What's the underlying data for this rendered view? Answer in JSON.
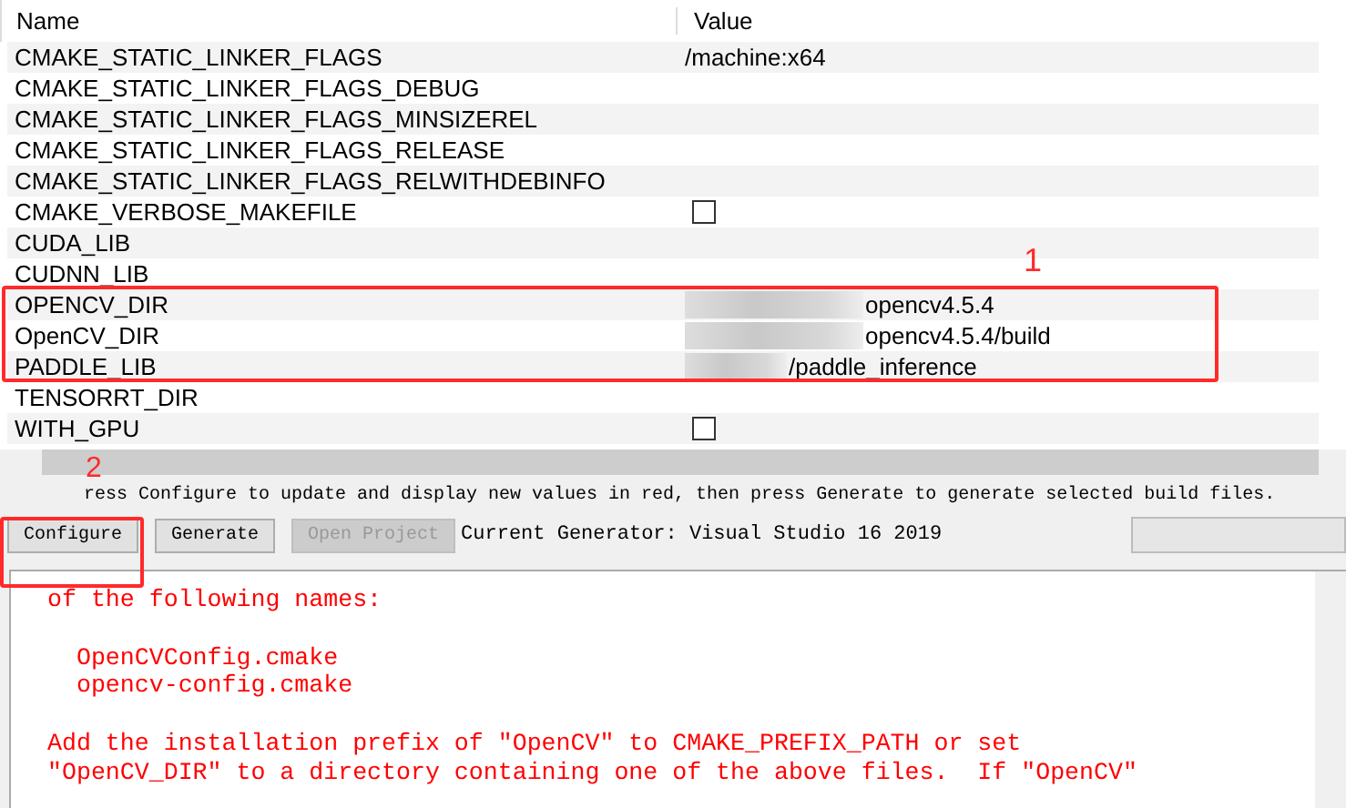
{
  "table": {
    "columns": [
      "Name",
      "Value"
    ],
    "rows": [
      {
        "name": "CMAKE_STATIC_LINKER_FLAGS",
        "kind": "text",
        "value": "/machine:x64"
      },
      {
        "name": "CMAKE_STATIC_LINKER_FLAGS_DEBUG",
        "kind": "text"
      },
      {
        "name": "CMAKE_STATIC_LINKER_FLAGS_MINSIZEREL",
        "kind": "text"
      },
      {
        "name": "CMAKE_STATIC_LINKER_FLAGS_RELEASE",
        "kind": "text"
      },
      {
        "name": "CMAKE_STATIC_LINKER_FLAGS_RELWITHDEBINFO",
        "kind": "text"
      },
      {
        "name": "CMAKE_VERBOSE_MAKEFILE",
        "kind": "checkbox",
        "checked": false
      },
      {
        "name": "CUDA_LIB",
        "kind": "text"
      },
      {
        "name": "CUDNN_LIB",
        "kind": "text"
      },
      {
        "name": "OPENCV_DIR",
        "kind": "redacted",
        "value": "opencv4.5.4"
      },
      {
        "name": "OpenCV_DIR",
        "kind": "redacted",
        "value": "opencv4.5.4/build"
      },
      {
        "name": "PADDLE_LIB",
        "kind": "redacted_short",
        "value": "/paddle_inference"
      },
      {
        "name": "TENSORRT_DIR",
        "kind": "text"
      },
      {
        "name": "WITH_GPU",
        "kind": "checkbox",
        "checked": false
      }
    ]
  },
  "hint": "ress Configure to update and display new values in red, then press Generate to generate selected build files.",
  "buttons": [
    {
      "label": "Configure",
      "disabled": false
    },
    {
      "label": "Generate",
      "disabled": false
    },
    {
      "label": "Open Project",
      "disabled": true
    }
  ],
  "generator": "Current Generator: Visual Studio 16 2019",
  "progress": {
    "level": 0
  },
  "output": [
    [
      "of the following names:"
    ],
    [
      "  OpenCVConfig.cmake",
      "  opencv-config.cmake"
    ],
    [
      "Add the installation prefix of \"OpenCV\" to CMAKE_PREFIX_PATH or set",
      "\"OpenCV_DIR\" to a directory containing one of the above files.  If \"OpenCV\""
    ]
  ],
  "annotations": [
    {
      "label": "1"
    },
    {
      "label": "2"
    }
  ]
}
